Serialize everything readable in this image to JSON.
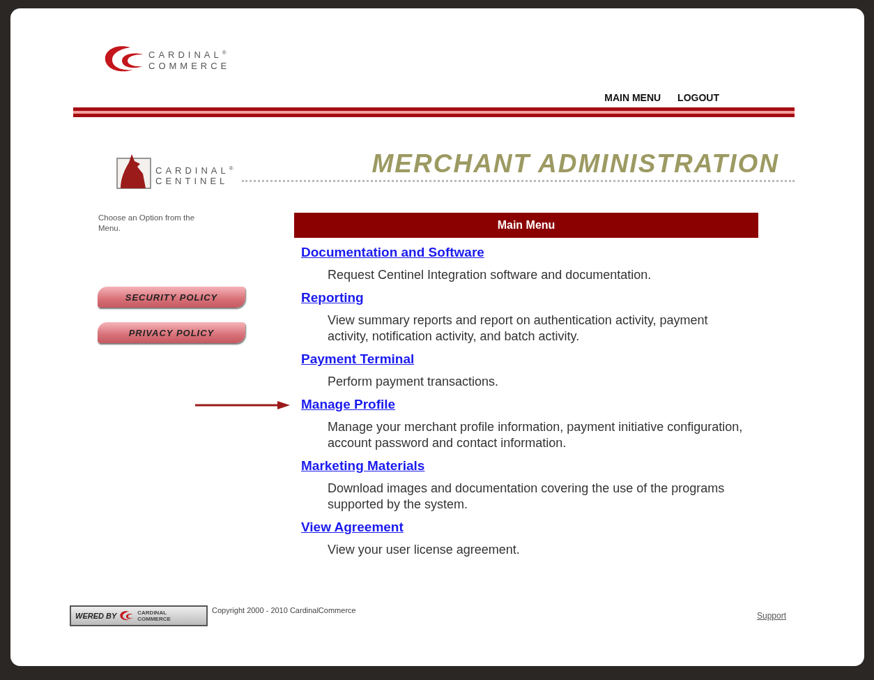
{
  "header": {
    "logo": {
      "line_1": "CARDINAL",
      "mark": "®",
      "line_2": "COMMERCE"
    },
    "nav": [
      {
        "label": "MAIN MENU"
      },
      {
        "label": "LOGOUT"
      }
    ]
  },
  "banner": {
    "logo": {
      "line_1": "CARDINAL",
      "mark": "®",
      "line_2": "CENTINEL"
    },
    "title": "MERCHANT ADMINISTRATION"
  },
  "sidebar": {
    "hint": "Choose an Option from the Menu.",
    "buttons": [
      {
        "label": "SECURITY POLICY"
      },
      {
        "label": "PRIVACY POLICY"
      }
    ]
  },
  "menu": {
    "title": "Main Menu",
    "items": [
      {
        "link": "Documentation and Software",
        "description": "Request Centinel Integration software and documentation.",
        "pointed": false
      },
      {
        "link": "Reporting",
        "description": "View summary reports and report on authentication activity, payment activity, notification activity, and batch activity.",
        "pointed": false
      },
      {
        "link": "Payment Terminal",
        "description": "Perform payment transactions.",
        "pointed": false
      },
      {
        "link": "Manage Profile",
        "description": "Manage your merchant profile information, payment initiative configuration, account password and contact information.",
        "pointed": true
      },
      {
        "link": "Marketing Materials",
        "description": "Download images and documentation covering the use of the programs supported by the system.",
        "pointed": false
      },
      {
        "link": "View Agreement",
        "description": "View your user license agreement.",
        "pointed": false
      }
    ]
  },
  "footer": {
    "badge": {
      "label": "WERED BY",
      "line_1": "CARDINAL",
      "line_2": "COMMERCE"
    },
    "copyright": "Copyright 2000 - 2010 CardinalCommerce",
    "support": "Support"
  }
}
